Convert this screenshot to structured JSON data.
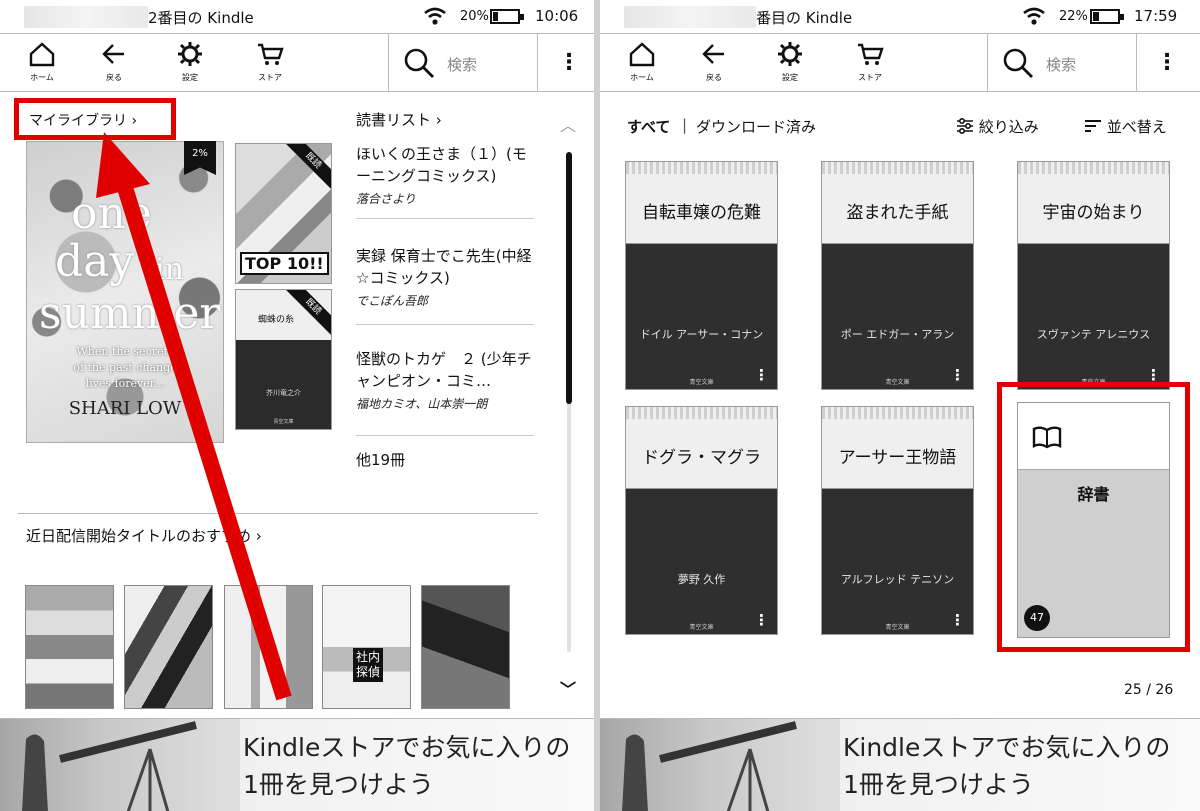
{
  "left": {
    "status": {
      "title": "2番目の Kindle",
      "battery": "20%",
      "battery_level": 0.2,
      "time": "10:06"
    },
    "toolbar": {
      "home": "ホーム",
      "back": "戻る",
      "settings": "設定",
      "store": "ストア",
      "search_placeholder": "検索"
    },
    "my_library": "マイライブラリ",
    "reading_list_title": "読書リスト",
    "featured_book": {
      "line1": "one",
      "line2": "day",
      "line3": "in",
      "line4": "summer",
      "subtitle1": "When the secrets",
      "subtitle2": "of the past change",
      "subtitle3": "lives forever...",
      "author": "SHARI LOW",
      "progress": "2%"
    },
    "mini_books": [
      {
        "tag": "TOP 10!!",
        "sash": "既読"
      },
      {
        "title": "蜘蛛の糸",
        "author": "芥川竜之介",
        "publisher": "青空文庫",
        "sash": "既読"
      }
    ],
    "reading_list": [
      {
        "title": "ほいくの王さま（１）(モーニングコミックス)",
        "author": "落合さより"
      },
      {
        "title": "実録 保育士でこ先生(中経☆コミックス)",
        "author": "でこぽん吾郎"
      },
      {
        "title": "怪獣のトカゲ　２ (少年チャンピオン・コミ…",
        "author": "福地カミオ、山本崇一朗"
      }
    ],
    "more": "他19冊",
    "recommend_title": "近日配信開始タイトルのおすすめ",
    "recommend_tag": "社内探偵"
  },
  "right": {
    "status": {
      "title": "番目の Kindle",
      "battery": "22%",
      "battery_level": 0.22,
      "time": "17:59"
    },
    "toolbar": {
      "home": "ホーム",
      "back": "戻る",
      "settings": "設定",
      "store": "ストア",
      "search_placeholder": "検索"
    },
    "filter_all": "すべて",
    "filter_sep": "|",
    "filter_downloaded": "ダウンロード済み",
    "refine": "絞り込み",
    "sort": "並べ替え",
    "books": [
      {
        "title": "自転車嬢の危難",
        "author": "ドイル アーサー・コナン",
        "publisher": "青空文庫"
      },
      {
        "title": "盗まれた手紙",
        "author": "ポー エドガー・アラン",
        "publisher": "青空文庫"
      },
      {
        "title": "宇宙の始まり",
        "author": "スヴァンテ アレニウス",
        "publisher": "青空文庫"
      },
      {
        "title": "ドグラ・マグラ",
        "author": "夢野 久作",
        "publisher": "青空文庫"
      },
      {
        "title": "アーサー王物語",
        "author": "アルフレッド テニソン",
        "publisher": "青空文庫"
      }
    ],
    "dictionary": {
      "title": "辞書",
      "count": "47"
    },
    "page": "25 / 26"
  },
  "banner": {
    "line1": "Kindleストアでお気に入りの",
    "line2": "1冊を見つけよう"
  },
  "colors": {
    "highlight": "#e10000",
    "ink": "#111111"
  }
}
